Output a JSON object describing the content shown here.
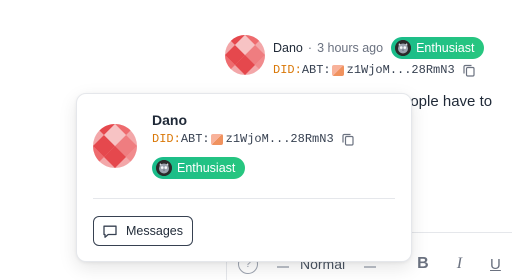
{
  "comment": {
    "author": "Dano",
    "separator": "·",
    "time": "3 hours ago",
    "badge": {
      "label": "Enthusiast",
      "icon": "owl-medal-icon",
      "color": "#1fbf85"
    },
    "did": {
      "prefix": "DID:",
      "middle": "ABT:",
      "emoji": "hands-emoji",
      "address": "z1WjoM...28RmN3"
    },
    "text_fragment": "eople have to"
  },
  "popover": {
    "name": "Dano",
    "did": {
      "prefix": "DID:",
      "middle": "ABT:",
      "emoji": "hands-emoji",
      "address": "z1WjoM...28RmN3"
    },
    "badge": {
      "label": "Enthusiast",
      "icon": "owl-medal-icon",
      "color": "#1fbf85"
    },
    "messages_button": "Messages"
  },
  "toolbar": {
    "help_glyph": "?",
    "style_label": "Normal",
    "bold_label": "B",
    "italic_label": "I",
    "underline_label": "U"
  },
  "colors": {
    "accent_green": "#1fbf85",
    "did_orange": "#d97706",
    "avatar_red": "#e5484d"
  }
}
